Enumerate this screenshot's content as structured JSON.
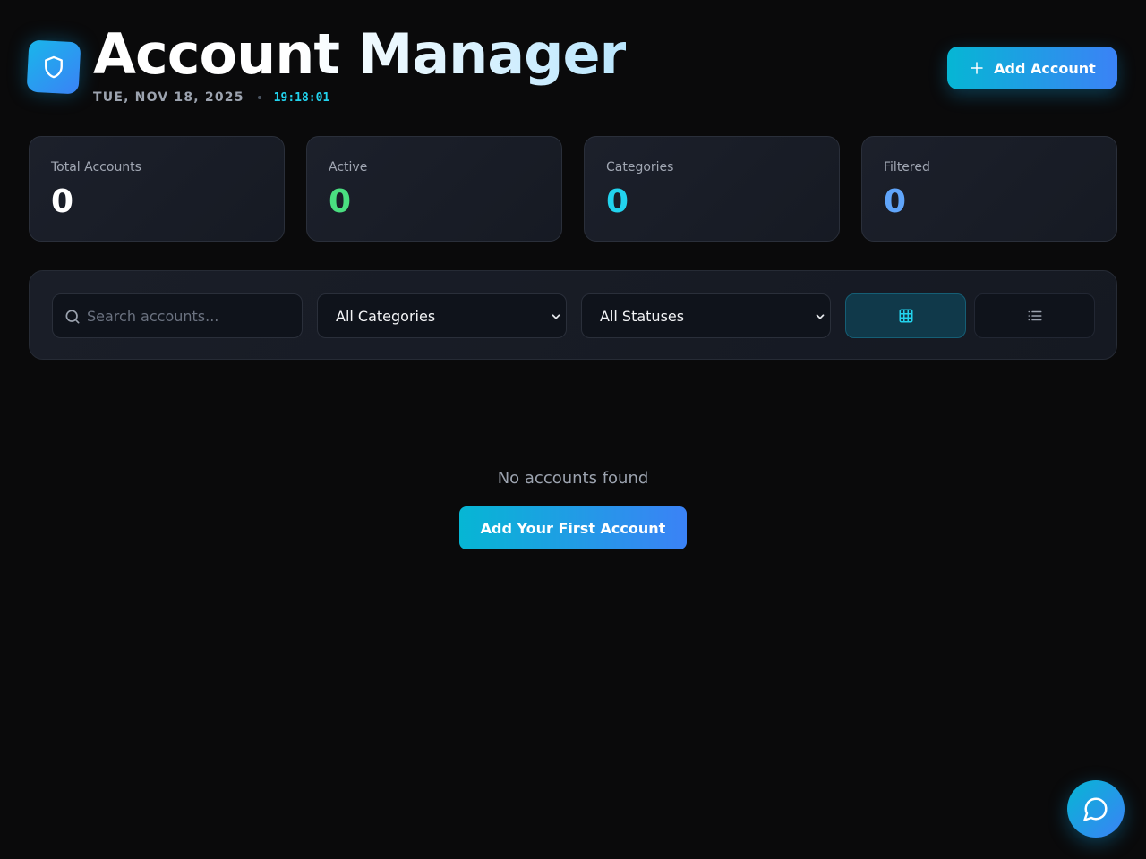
{
  "header": {
    "title": "Account Manager",
    "date": "TUE, NOV 18, 2025",
    "time": "19:18:01",
    "add_button_label": "Add Account",
    "logo_icon": "shield-icon"
  },
  "stats": [
    {
      "label": "Total Accounts",
      "value": "0",
      "color": "#ffffff"
    },
    {
      "label": "Active",
      "value": "0",
      "color": "#4ade80"
    },
    {
      "label": "Categories",
      "value": "0",
      "color": "#22d3ee"
    },
    {
      "label": "Filtered",
      "value": "0",
      "color": "#60a5fa"
    }
  ],
  "filters": {
    "search_placeholder": "Search accounts...",
    "search_value": "",
    "category_selected": "All Categories",
    "status_selected": "All Statuses",
    "view_mode": "grid",
    "grid_icon": "grid-icon",
    "list_icon": "list-icon"
  },
  "empty_state": {
    "message": "No accounts found",
    "button_label": "Add Your First Account"
  },
  "chat": {
    "icon": "chat-icon"
  },
  "colors": {
    "accent_start": "#06b6d4",
    "accent_end": "#3b82f6",
    "background": "#0a0a0b"
  }
}
